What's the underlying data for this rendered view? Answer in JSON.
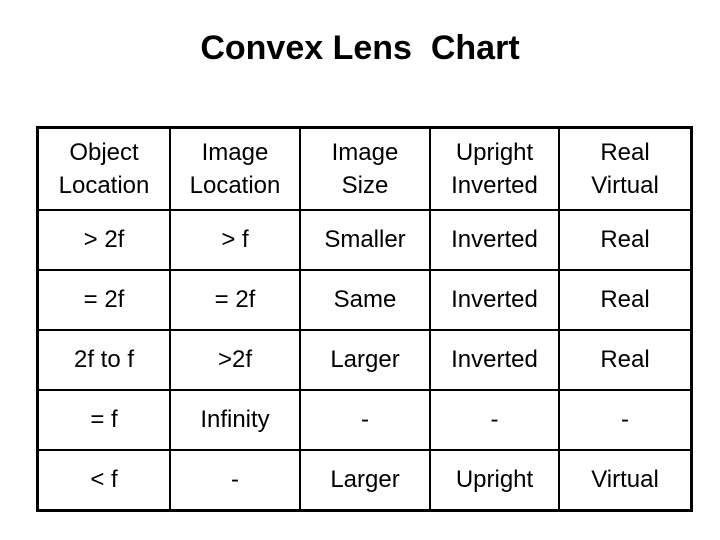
{
  "title": "Convex Lens  Chart",
  "table": {
    "headers": [
      {
        "line1": "Object",
        "line2": "Location"
      },
      {
        "line1": "Image",
        "line2": "Location"
      },
      {
        "line1": "Image",
        "line2": "Size"
      },
      {
        "line1": "Upright",
        "line2": "Inverted"
      },
      {
        "line1": "Real",
        "line2": "Virtual"
      }
    ],
    "rows": [
      [
        "> 2f",
        "> f",
        "Smaller",
        "Inverted",
        "Real"
      ],
      [
        "= 2f",
        "= 2f",
        "Same",
        "Inverted",
        "Real"
      ],
      [
        "2f to f",
        ">2f",
        "Larger",
        "Inverted",
        "Real"
      ],
      [
        "= f",
        "Infinity",
        "-",
        "-",
        "-"
      ],
      [
        "< f",
        "-",
        "Larger",
        "Upright",
        "Virtual"
      ]
    ]
  }
}
